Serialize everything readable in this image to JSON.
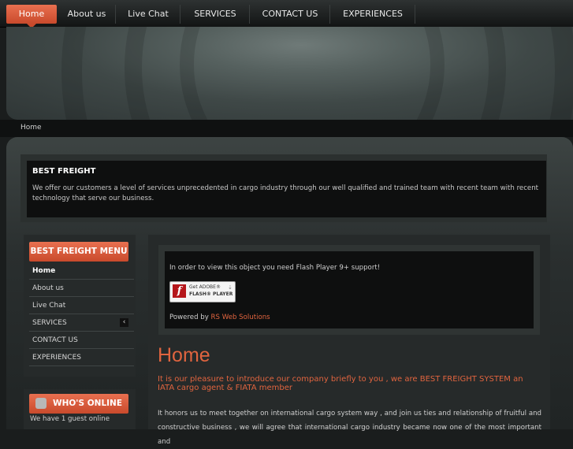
{
  "nav": {
    "items": [
      {
        "label": "Home"
      },
      {
        "label": "About us"
      },
      {
        "label": "Live Chat"
      },
      {
        "label": "SERVICES"
      },
      {
        "label": "CONTACT US"
      },
      {
        "label": "EXPERIENCES"
      }
    ]
  },
  "breadcrumb": {
    "label": "Home"
  },
  "intro": {
    "title": "BEST FREIGHT",
    "text": "We offer our customers a level of services unprecedented in cargo industry through our well qualified and trained team with recent team with recent technology that serve our business."
  },
  "sidebar": {
    "menu_title": "BEST FREIGHT MENU",
    "items": [
      {
        "label": "Home"
      },
      {
        "label": "About us"
      },
      {
        "label": "Live Chat"
      },
      {
        "label": "SERVICES"
      },
      {
        "label": "CONTACT US"
      },
      {
        "label": "EXPERIENCES"
      }
    ],
    "online_title": "WHO'S ONLINE",
    "online_text": "We have 1 guest online"
  },
  "flash": {
    "message": "In order to view this object you need Flash Player 9+ support!",
    "badge_line1": "Get ADOBE®",
    "badge_line2": "FLASH® PLAYER",
    "powered_prefix": "Powered by",
    "powered_link": "RS Web Solutions"
  },
  "content": {
    "heading": "Home",
    "lead": "It is our pleasure to introduce our company briefly to you , we are BEST FREIGHT SYSTEM an IATA cargo agent  & FIATA member",
    "paragraph": "It honors us to meet together on international cargo system way , and join us ties and relationship of fruitful and constructive business , we will agree that international cargo industry became now one of the most important and"
  },
  "colors": {
    "accent": "#e0643f",
    "nav_active": "#d85a3a",
    "panel_dark": "#0e0f0f"
  }
}
